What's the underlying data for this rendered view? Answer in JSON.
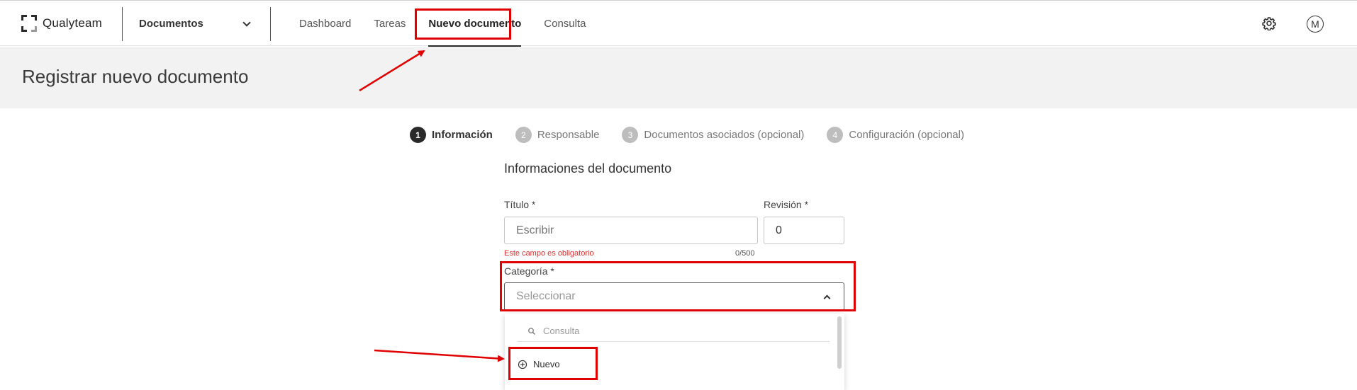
{
  "header": {
    "brand": "Qualyteam",
    "module_label": "Documentos",
    "nav": [
      {
        "label": "Dashboard"
      },
      {
        "label": "Tareas"
      },
      {
        "label": "Nuevo documento"
      },
      {
        "label": "Consulta"
      }
    ],
    "settings_icon": "gear-icon",
    "avatar_initial": "M"
  },
  "page": {
    "title": "Registrar nuevo documento"
  },
  "stepper": {
    "steps": [
      {
        "num": "1",
        "label": "Información",
        "active": true
      },
      {
        "num": "2",
        "label": "Responsable",
        "active": false
      },
      {
        "num": "3",
        "label": "Documentos asociados (opcional)",
        "active": false
      },
      {
        "num": "4",
        "label": "Configuración (opcional)",
        "active": false
      }
    ]
  },
  "form": {
    "section_title": "Informaciones del documento",
    "title_label": "Título *",
    "title_placeholder": "Escribir",
    "title_error": "Este campo es obligatorio",
    "title_counter": "0/500",
    "revision_label": "Revisión *",
    "revision_value": "0",
    "category_label": "Categoría *",
    "category_placeholder": "Seleccionar",
    "dropdown": {
      "search_placeholder": "Consulta",
      "option_new": "Nuevo"
    }
  },
  "annotations": {
    "color": "#e00000"
  }
}
